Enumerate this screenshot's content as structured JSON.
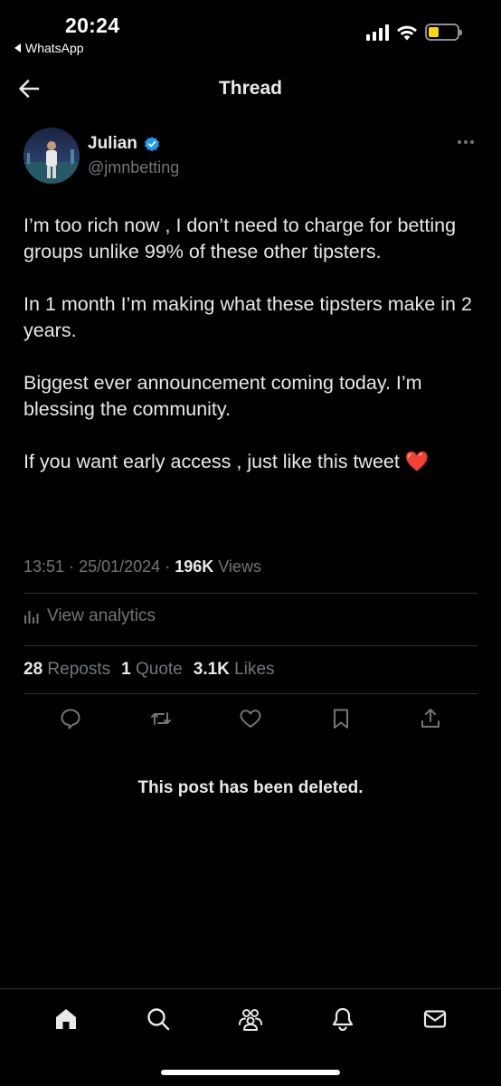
{
  "status_bar": {
    "time": "20:24",
    "back_app": "WhatsApp",
    "battery_color": "#ffd60a"
  },
  "header": {
    "title": "Thread",
    "back_icon": "back-arrow-icon"
  },
  "author": {
    "name": "Julian",
    "handle": "@jmnbetting",
    "verified_color": "#1d9bf0"
  },
  "post": {
    "paragraphs": [
      "I’m too rich now , I don’t need to charge for betting groups unlike 99% of these other tipsters.",
      "In 1 month I’m making what these tipsters make in 2 years.",
      "Biggest ever announcement coming today. I’m blessing the community.",
      "If you want early access , just like this tweet"
    ],
    "emoji": "❤️",
    "time": "13:51",
    "date": "25/01/2024",
    "views_count": "196K",
    "views_label": "Views"
  },
  "analytics_label": "View analytics",
  "stats": {
    "reposts_count": "28",
    "reposts_label": "Reposts",
    "quotes_count": "1",
    "quotes_label": "Quote",
    "likes_count": "3.1K",
    "likes_label": "Likes"
  },
  "actions": [
    "reply-icon",
    "repost-icon",
    "like-icon",
    "bookmark-icon",
    "share-icon"
  ],
  "deleted_notice": "This post has been deleted.",
  "bottom_nav": [
    "home-icon",
    "search-icon",
    "communities-icon",
    "notifications-icon",
    "messages-icon"
  ],
  "colors": {
    "background": "#000000",
    "text": "#e7e9ea",
    "muted": "#71767b",
    "divider": "#2f3336",
    "accent": "#1d9bf0"
  }
}
